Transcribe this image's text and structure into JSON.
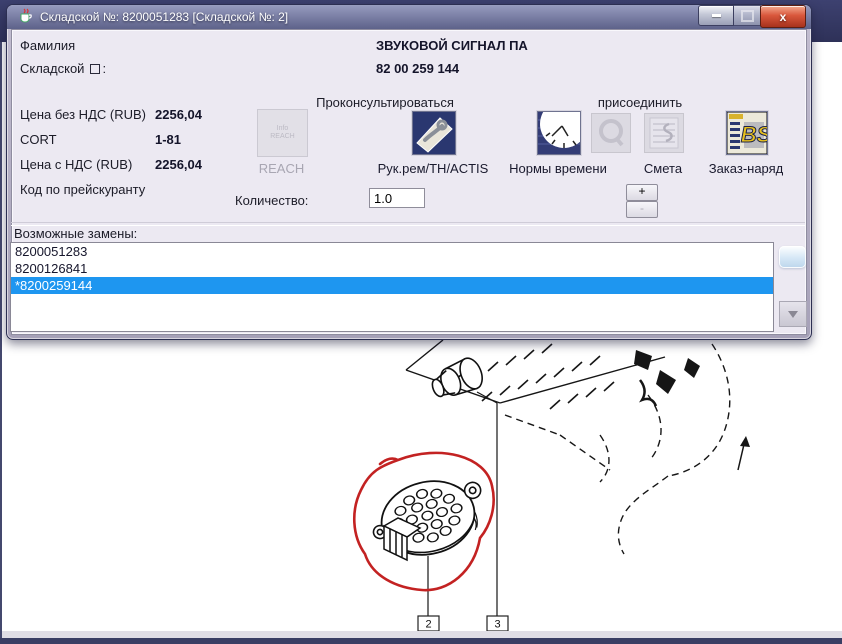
{
  "window": {
    "title": "Складской №: 8200051283 [Складской №: 2]",
    "close_glyph": "x"
  },
  "header_fields": {
    "name_label": "Фамилия",
    "name_value": "ЗВУКОВОЙ СИГНАЛ ПА",
    "sku_label": "Складской",
    "sku_colon": ":",
    "sku_value": "82 00 259 144"
  },
  "pricing": {
    "rows": [
      {
        "label": "Цена без НДС (RUB)",
        "value": "2256,04"
      },
      {
        "label": "CORT",
        "value": "1-81"
      },
      {
        "label": "Цена с НДС (RUB)",
        "value": "2256,04"
      },
      {
        "label": "Код по прейскуранту",
        "value": ""
      }
    ]
  },
  "toolbar": {
    "consult_group_label": "Проконсультироваться",
    "attach_group_label": "присоединить",
    "reach_icon_line1": "Info",
    "reach_icon_line2": "REACH",
    "reach_label": "REACH",
    "manual_label": "Рук.рем/TH/ACTIS",
    "time_label": "Нормы времени",
    "estimate_label": "Смета",
    "order_label": "Заказ-наряд",
    "order_icon_text": "BS"
  },
  "quantity": {
    "label": "Количество:",
    "value": "1.0",
    "plus": "+",
    "minus": "-"
  },
  "replacements": {
    "label": "Возможные замены:",
    "items": [
      {
        "text": "8200051283",
        "selected": false
      },
      {
        "text": "8200126841",
        "selected": false
      },
      {
        "text": "*8200259144",
        "selected": true
      }
    ]
  },
  "diagram": {
    "callout_2": "2",
    "callout_3": "3"
  },
  "colors": {
    "selection_blue": "#1e96f0",
    "titlebar_navy": "#343a66",
    "close_red": "#b0351e",
    "annotation_red": "#c32222"
  }
}
